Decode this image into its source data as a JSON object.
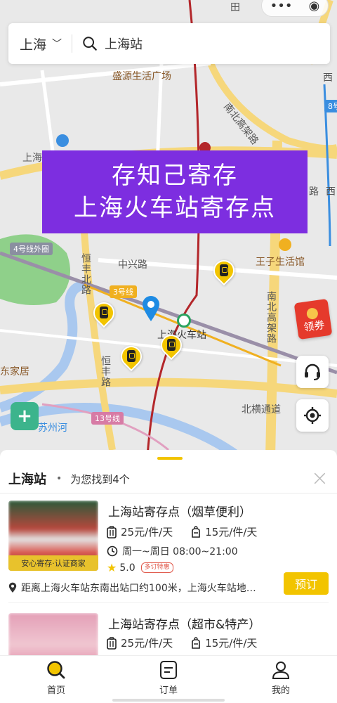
{
  "search": {
    "city": "上海",
    "query": "上海站"
  },
  "map": {
    "labels": {
      "plaza": "盛源生活广场",
      "shanghai_left": "上海",
      "nanbei_top": "南北高架路",
      "xi": "西",
      "line8": "8号",
      "xi2": "西",
      "lu": "路",
      "line4": "4号线外圈",
      "zhongxing": "中兴路",
      "wangzi": "王子生活馆",
      "hengfeng_n": "恒丰北路",
      "line3": "3号线",
      "station": "上海火车站",
      "nanbei_right": "南北高架路",
      "jiaju": "东家居",
      "hengfeng": "恒丰路",
      "beiheng": "北横通道",
      "line13": "13号线",
      "suzhou": "苏州河",
      "tian": "田"
    },
    "colors": {
      "banner": "#7d2ee0",
      "pin": "#f2c400",
      "rail": "#b3262a"
    }
  },
  "banner": {
    "line1": "存知己寄存",
    "line2": "上海火车站寄存点"
  },
  "coupon": {
    "label": "领券"
  },
  "sheet": {
    "title": "上海站",
    "dot": "•",
    "count_text": "为您找到4个",
    "close": "×",
    "cards": [
      {
        "title": "上海站寄存点（烟草便利）",
        "tag": "安心寄存·认证商家",
        "price_luggage": "25元/件/天",
        "price_bag": "15元/件/天",
        "hours": "周一~周日 08:00~21:00",
        "rating": "5.0",
        "badge": "多订特惠",
        "address": "距离上海火车站东南出站口约100米，上海火车站地…",
        "book": "预订"
      },
      {
        "title": "上海站寄存点（超市&特产）",
        "price_luggage": "25元/件/天",
        "price_bag": "15元/件/天"
      }
    ]
  },
  "nav": {
    "home": "首页",
    "orders": "订单",
    "mine": "我的"
  }
}
